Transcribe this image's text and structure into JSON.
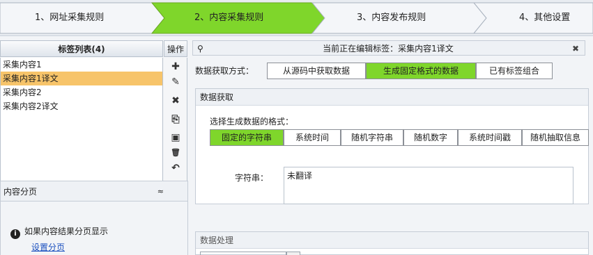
{
  "steps": [
    {
      "label": "1、网址采集规则",
      "active": false
    },
    {
      "label": "2、内容采集规则",
      "active": true
    },
    {
      "label": "3、内容发布规则",
      "active": false
    },
    {
      "label": "4、其他设置",
      "active": false
    }
  ],
  "left": {
    "tag_list_title": "标签列表(4)",
    "ops_title": "操作",
    "tags": [
      "采集内容1",
      "采集内容1译文",
      "采集内容2",
      "采集内容2译文"
    ],
    "selected_tag_index": 1,
    "ops_icons": [
      "add-icon",
      "edit-icon",
      "delete-icon",
      "copy-icon",
      "paste-icon",
      "trash-icon",
      "undo-icon"
    ],
    "ops_glyphs": [
      "✚",
      "✎",
      "✖",
      "⎘",
      "▣",
      "🗑",
      "↶"
    ],
    "page_section_title": "内容分页",
    "page_collapse_glyph": "≈",
    "info_text": "如果内容结果分页显示",
    "info_glyph": "i",
    "set_page_link": "设置分页"
  },
  "right": {
    "editing_title": "当前正在编辑标签：采集内容1译文",
    "pin_glyph": "⚲",
    "close_glyph": "✖",
    "mode_label": "数据获取方式：",
    "modes": [
      "从源码中获取数据",
      "生成固定格式的数据",
      "已有标签组合"
    ],
    "active_mode_index": 1,
    "fetch_section_title": "数据获取",
    "format_label": "选择生成数据的格式：",
    "formats": [
      "固定的字符串",
      "系统时间",
      "随机字符串",
      "随机数字",
      "系统时间戳",
      "随机抽取信息"
    ],
    "active_format_index": 0,
    "string_label": "字符串：",
    "string_value": "未翻译",
    "process_section_title": "数据处理"
  },
  "colors": {
    "accent_green": "#7fd62b",
    "selected_orange": "#f7c46a",
    "step_active": "#7fd62b"
  }
}
